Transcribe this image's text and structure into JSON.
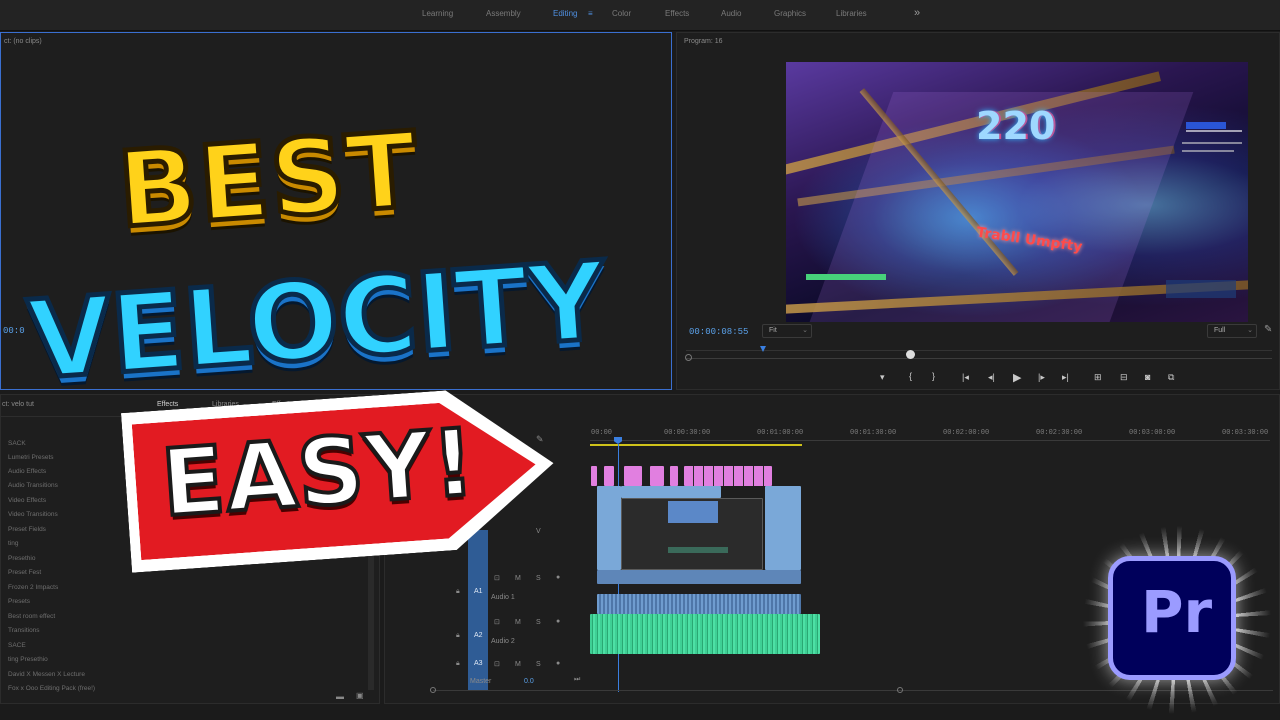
{
  "workspaces": {
    "tabs": [
      "Learning",
      "Assembly",
      "Editing",
      "Color",
      "Effects",
      "Audio",
      "Graphics",
      "Libraries"
    ],
    "active": "Editing",
    "more": "»"
  },
  "source_panel": {
    "title": "ct: (no clips)",
    "timecode": "00:0"
  },
  "program_panel": {
    "title": "Program: 16",
    "timecode": "00:00:08:55",
    "fit": "Fit",
    "quality": "Full",
    "game": {
      "score": "220",
      "name_tag": "Trabll Umpfty"
    }
  },
  "project_panel": {
    "title": "ct: velo tut",
    "tabs": [
      "Effects",
      "Libraries",
      "Effect Controls"
    ],
    "items": [
      "SACK",
      "Lumetri Presets",
      "Audio Effects",
      "Audio Transitions",
      "Video Effects",
      "Video Transitions",
      "Preset Fields",
      "ting",
      "Presethio",
      "Preset Fest",
      "Frozen 2 Impacts",
      "Presets",
      "Best room effect",
      "Transitions",
      "SACE",
      "ting Presethio",
      "David X Messen X Lecture",
      "Fox x Ooo Editing Pack (free!)"
    ]
  },
  "timeline": {
    "ruler": [
      "00:00",
      "00:00:30:00",
      "00:01:00:00",
      "00:01:30:00",
      "00:02:00:00",
      "00:02:30:00",
      "00:03:00:00",
      "00:03:30:00"
    ],
    "tracks": [
      {
        "id": "A1",
        "name": "Audio 1"
      },
      {
        "id": "A2",
        "name": "Audio 2"
      },
      {
        "id": "A3",
        "name": ""
      }
    ],
    "master": {
      "label": "Master",
      "value": "0.0"
    },
    "video_label": "V",
    "mute": "M",
    "solo": "S"
  },
  "thumbnail": {
    "line1": "BEST",
    "line2": "VELOCITY",
    "line3": "EASY!",
    "logo": "Pr"
  },
  "colors": {
    "yellow": "#ffd21a",
    "cyan": "#31d2ff",
    "red": "#e21b22",
    "audio_green": "#3fcf95",
    "pink_clip": "#e17fe0",
    "clip_blue": "#7aa8d8",
    "pr_purple": "#9b9bff",
    "pr_bg": "#00005b"
  }
}
